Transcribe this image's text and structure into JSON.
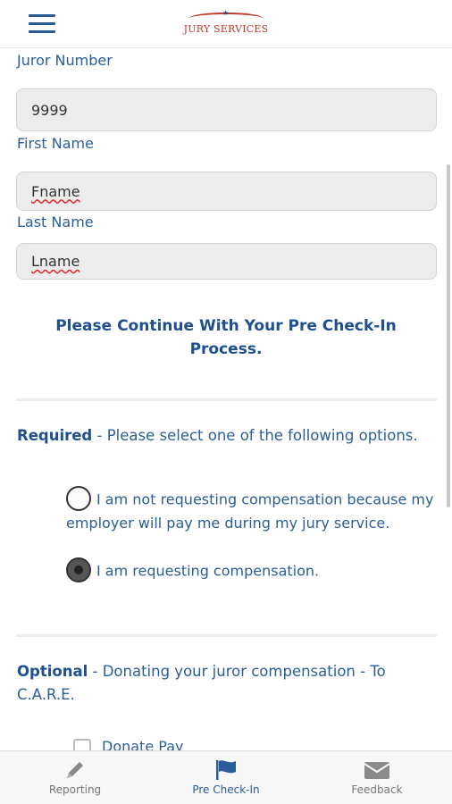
{
  "header": {
    "menu_icon": "hamburger-menu-icon",
    "logo_text": "JURY SERVICES"
  },
  "form": {
    "juror_number_label": "Juror Number",
    "juror_number_value": "9999",
    "first_name_label": "First Name",
    "first_name_value": "Fname",
    "last_name_label": "Last Name",
    "last_name_value": "Lname"
  },
  "notice": "Please Continue With Your Pre Check-In Process.",
  "required": {
    "heading": "Required",
    "text": " - Please select one of the following options.",
    "options": [
      {
        "label": "I am not requesting compensation because my employer will pay me during my jury service.",
        "selected": false
      },
      {
        "label": "I am requesting compensation.",
        "selected": true
      }
    ]
  },
  "optional": {
    "heading": "Optional",
    "text": " - Donating your juror compensation - To C.A.R.E.",
    "checkbox_label": "Donate Pay",
    "checked": false
  },
  "tabs": [
    {
      "label": "Reporting",
      "icon": "pencil-icon",
      "active": false
    },
    {
      "label": "Pre Check-In",
      "icon": "flag-icon",
      "active": true
    },
    {
      "label": "Feedback",
      "icon": "envelope-icon",
      "active": false
    }
  ],
  "colors": {
    "accent": "#1d4f91",
    "logo_red": "#c0392b"
  }
}
